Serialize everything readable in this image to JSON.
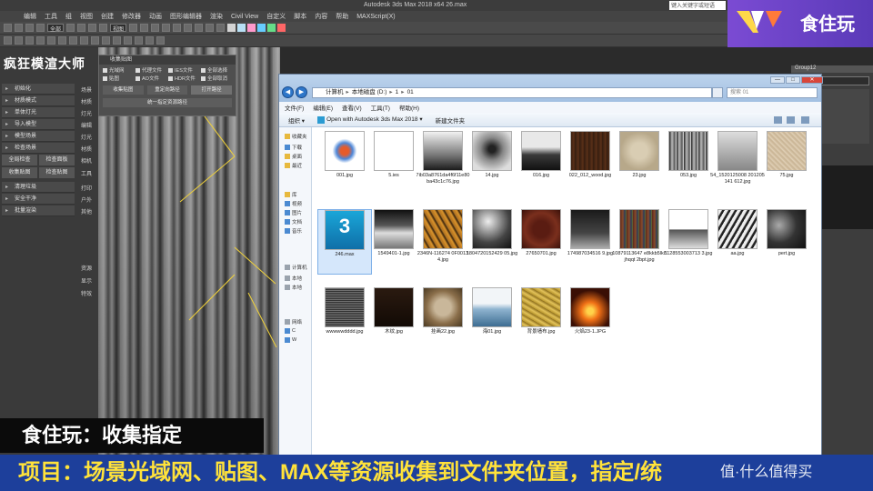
{
  "max": {
    "title": "Autodesk 3ds Max 2018 x64   26.max",
    "search_placeholder": "键入关键字或短语",
    "menu": [
      "编辑",
      "工具",
      "组",
      "视图",
      "创建",
      "修改器",
      "动画",
      "图形编辑器",
      "渲染",
      "Civil View",
      "自定义",
      "脚本",
      "内容",
      "帮助",
      "MAXScript(X)"
    ],
    "toolbar_dropdown": "全部",
    "toolbar_dropdown2": "视图",
    "swatch_colors": [
      "#d4d4d4",
      "#b8e0f5",
      "#ff99cc",
      "#66ccff",
      "#66dd88",
      "#ff6666"
    ]
  },
  "brand": {
    "name": "食住玩"
  },
  "left_panel": {
    "title": "疯狂模渲大师",
    "rows": [
      {
        "label": "初始化",
        "side": "场景"
      },
      {
        "label": "材质模式",
        "side": "材质"
      },
      {
        "label": "单体灯光",
        "side": "灯光"
      },
      {
        "label": "导入模型",
        "side": "编辑"
      },
      {
        "label": "模型场景",
        "side": "灯光"
      },
      {
        "label": "检查场景",
        "side": "材质"
      }
    ],
    "pairs": [
      {
        "a": "全局检查",
        "b": "检查面板",
        "side": "相机"
      },
      {
        "a": "收集贴图",
        "b": "检查贴图",
        "side": "工具"
      }
    ],
    "rows2": [
      {
        "label": "清理垃圾",
        "side": "打印"
      },
      {
        "label": "安全干净",
        "side": "户外"
      },
      {
        "label": "批量渲染",
        "side": "其他"
      }
    ],
    "side_lower": [
      "资源",
      "显示",
      "特效"
    ]
  },
  "ck_dialog": {
    "title": "收集贴图",
    "items": [
      "光域网",
      "代理文件",
      "IES文件",
      "全部选择",
      "贴图",
      "AO文件",
      "HDR文件",
      "全部取消"
    ],
    "btn_collect": "收集贴图",
    "btn_relink": "重定向路径",
    "btn_open": "打开路径",
    "btn_wide": "统一指定资源路径"
  },
  "right_panel": {
    "header": "Group12"
  },
  "explorer": {
    "window_controls": [
      "—",
      "□",
      "✕"
    ],
    "path": [
      "计算机",
      "本地磁盘 (D:)",
      "1",
      "01"
    ],
    "search_placeholder": "搜索 01",
    "menu": [
      "文件(F)",
      "编辑(E)",
      "查看(V)",
      "工具(T)",
      "帮助(H)"
    ],
    "cmd_organize": "组织 ▾",
    "cmd_open": "Open with Autodesk 3ds Max 2018 ▾",
    "cmd_new_folder": "新建文件夹",
    "nav_items": [
      "收藏夹",
      "下载",
      "桌面",
      "最近",
      "库",
      "视频",
      "图片",
      "文档",
      "音乐",
      "计算机",
      "本地",
      "本地",
      "网络",
      "C",
      "W"
    ],
    "files": [
      {
        "name": "001.jpg",
        "thumb": "t-parrot"
      },
      {
        "name": "5.ies",
        "thumb": "t-doc"
      },
      {
        "name": "7ib03a8761da4f6f11e80ba43c1c76.jpg",
        "thumb": "t-photo-bw"
      },
      {
        "name": "14.jpg",
        "thumb": "t-tree"
      },
      {
        "name": "016.jpg",
        "thumb": "t-stone"
      },
      {
        "name": "022_012_wood.jpg",
        "thumb": "t-wood"
      },
      {
        "name": "23.jpg",
        "thumb": "t-pillow"
      },
      {
        "name": "053.jpg",
        "thumb": "t-stripes"
      },
      {
        "name": "54_1520125008 201205141 612.jpg",
        "thumb": "t-eiffel"
      },
      {
        "name": "75.jpg",
        "thumb": "t-beige"
      },
      {
        "name": "246.max",
        "thumb": "t-max"
      },
      {
        "name": "1549401-1.jpg",
        "thumb": "t-bw-sea"
      },
      {
        "name": "2346N-116274 0F00134.jpg",
        "thumb": "t-tiger"
      },
      {
        "name": "1804720152429 05.jpg",
        "thumb": "t-storm"
      },
      {
        "name": "27650701.jpg",
        "thumb": "t-rug"
      },
      {
        "name": "174987034516 9.jpg",
        "thumb": "t-paris-night"
      },
      {
        "name": "10879113647 e8kkb5lk8jhqqt 2bpt.jpg",
        "thumb": "t-books"
      },
      {
        "name": "1128553003713 3.jpg",
        "thumb": "t-pier"
      },
      {
        "name": "aa.jpg",
        "thumb": "t-zebra"
      },
      {
        "name": "pert.jpg",
        "thumb": "t-marble"
      },
      {
        "name": "wwwwwdddd.jpg",
        "thumb": "t-grid"
      },
      {
        "name": "木纹.jpg",
        "thumb": "t-darkwood"
      },
      {
        "name": "挂画22.jpg",
        "thumb": "t-frame"
      },
      {
        "name": "海01.jpg",
        "thumb": "t-sea"
      },
      {
        "name": "背景墙布.jpg",
        "thumb": "t-gold"
      },
      {
        "name": "火焰23-1.JPG",
        "thumb": "t-fire"
      }
    ]
  },
  "captions": {
    "top": "食住玩：收集指定",
    "bottom": "项目：场景光域网、贴图、MAX等资源收集到文件夹位置，指定/统",
    "watermark": "值·什么值得买"
  }
}
